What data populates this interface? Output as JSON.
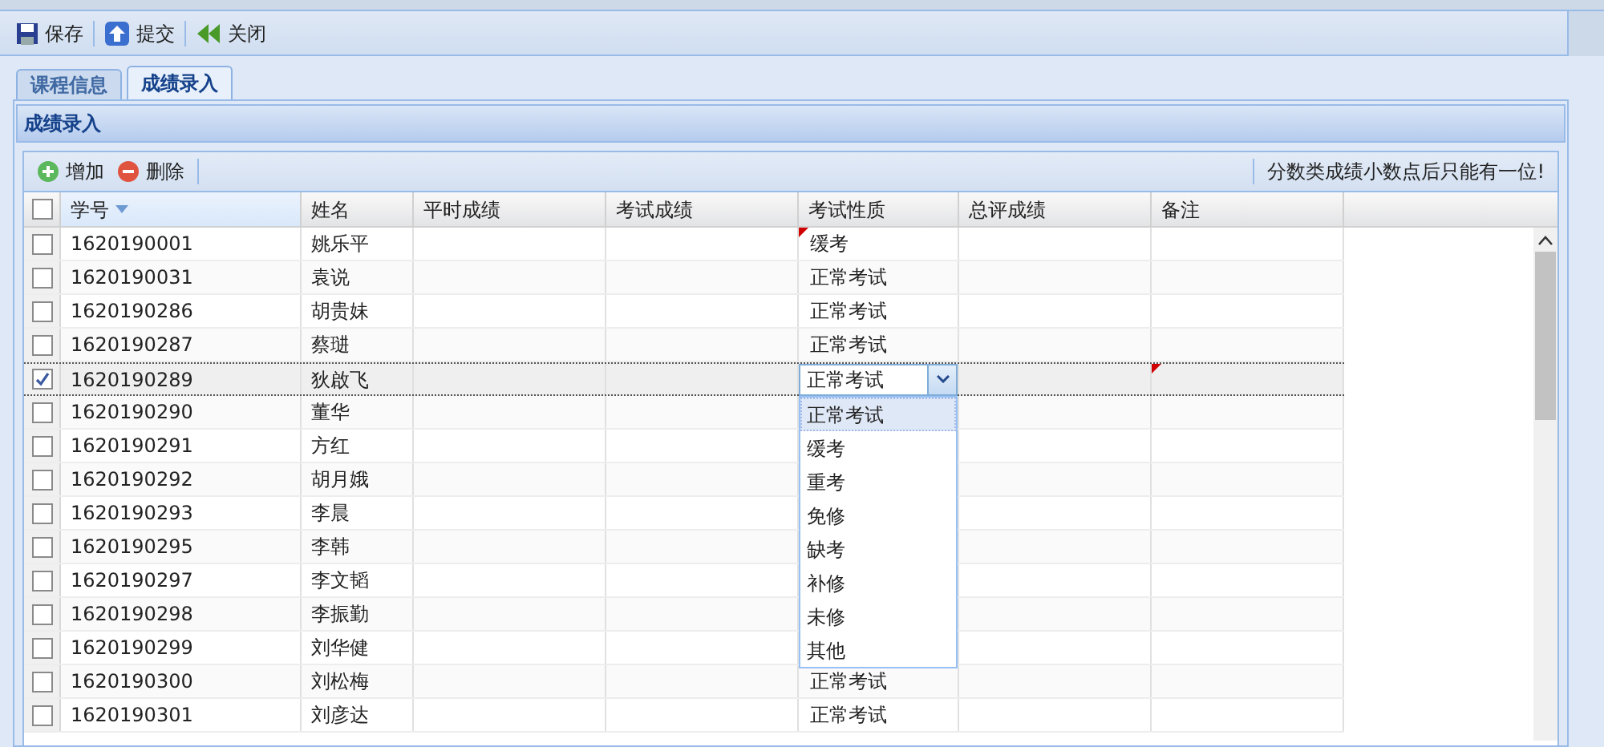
{
  "toolbar": [
    {
      "kind": "save",
      "label": "保存"
    },
    {
      "kind": "submit",
      "label": "提交"
    },
    {
      "kind": "close",
      "label": "关闭"
    }
  ],
  "tabs": [
    {
      "label": "课程信息",
      "selected": false
    },
    {
      "label": "成绩录入",
      "selected": true
    }
  ],
  "panel": {
    "title": "成绩录入"
  },
  "grid_toolbar": {
    "buttons": [
      {
        "kind": "add",
        "label": "增加"
      },
      {
        "kind": "delete",
        "label": "删除"
      }
    ],
    "hint": "分数类成绩小数点后只能有一位!"
  },
  "table": {
    "all_checked": false,
    "columns": [
      {
        "label": "学号",
        "sorted": true
      },
      {
        "label": "姓名",
        "sorted": false
      },
      {
        "label": "平时成绩",
        "sorted": false
      },
      {
        "label": "考试成绩",
        "sorted": false
      },
      {
        "label": "考试性质",
        "sorted": false
      },
      {
        "label": "总评成绩",
        "sorted": false
      },
      {
        "label": "备注",
        "sorted": false
      }
    ],
    "rows": [
      {
        "id": "1620190001",
        "name": "姚乐平",
        "exam_type": "缓考",
        "checked": false,
        "editing": false,
        "exam_modified": true,
        "remark_modified": false
      },
      {
        "id": "1620190031",
        "name": "袁说",
        "exam_type": "正常考试",
        "checked": false,
        "editing": false,
        "exam_modified": false,
        "remark_modified": false
      },
      {
        "id": "1620190286",
        "name": "胡贵妹",
        "exam_type": "正常考试",
        "checked": false,
        "editing": false,
        "exam_modified": false,
        "remark_modified": false
      },
      {
        "id": "1620190287",
        "name": "蔡琎",
        "exam_type": "正常考试",
        "checked": false,
        "editing": false,
        "exam_modified": false,
        "remark_modified": false
      },
      {
        "id": "1620190289",
        "name": "狄啟飞",
        "exam_type": "正常考试",
        "checked": true,
        "editing": true,
        "exam_modified": false,
        "remark_modified": true
      },
      {
        "id": "1620190290",
        "name": "董华",
        "checked": false,
        "editing": false,
        "remark_modified": false
      },
      {
        "id": "1620190291",
        "name": "方红",
        "checked": false,
        "editing": false,
        "remark_modified": false
      },
      {
        "id": "1620190292",
        "name": "胡月娥",
        "checked": false,
        "editing": false,
        "remark_modified": false
      },
      {
        "id": "1620190293",
        "name": "李晨",
        "checked": false,
        "editing": false,
        "remark_modified": false
      },
      {
        "id": "1620190295",
        "name": "李韩",
        "checked": false,
        "editing": false,
        "remark_modified": false
      },
      {
        "id": "1620190297",
        "name": "李文韬",
        "checked": false,
        "editing": false,
        "remark_modified": false
      },
      {
        "id": "1620190298",
        "name": "李振勤",
        "checked": false,
        "editing": false,
        "remark_modified": false
      },
      {
        "id": "1620190299",
        "name": "刘华健",
        "checked": false,
        "editing": false,
        "remark_modified": false
      },
      {
        "id": "1620190300",
        "name": "刘松梅",
        "exam_type": "正常考试",
        "checked": false,
        "editing": false,
        "exam_modified": false,
        "remark_modified": false
      },
      {
        "id": "1620190301",
        "name": "刘彦达",
        "exam_type": "正常考试",
        "checked": false,
        "editing": false,
        "exam_modified": false,
        "remark_modified": false
      }
    ]
  },
  "dropdown": {
    "options": [
      {
        "label": "正常考试",
        "selected": true
      },
      {
        "label": "缓考",
        "selected": false
      },
      {
        "label": "重考",
        "selected": false
      },
      {
        "label": "免修",
        "selected": false
      },
      {
        "label": "缺考",
        "selected": false
      },
      {
        "label": "补修",
        "selected": false
      },
      {
        "label": "未修",
        "selected": false
      },
      {
        "label": "其他",
        "selected": false
      }
    ]
  }
}
